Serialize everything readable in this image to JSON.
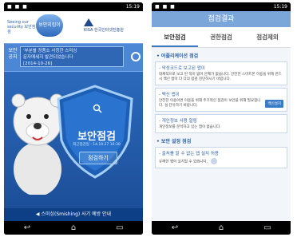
{
  "left_screen": {
    "status_time": "15:19",
    "logo_text": "Seeing our security 보안점검",
    "logo_badge": "보안지킴이",
    "org_name": "KISA 한국인터넷진흥원",
    "notice_tag": "보안 공지",
    "notice_lines": [
      "'부분별 정품소 사칭한 스미싱",
      "문자메세지 발견되었습니다",
      "[2014-10-26]"
    ],
    "shield_title": "보안점검",
    "shield_subtitle": "최근점검일 : 14.10.27 16:30",
    "shield_button": "점검하기",
    "bottom_banner": "◀ 스미싱(Smishing) 사기 예방 안내"
  },
  "right_screen": {
    "status_time": "15:19",
    "title": "점검결과",
    "tabs": [
      "보안점검",
      "권한점검",
      "점검제외"
    ],
    "section1_title": "• 어플리케이션 점검",
    "card1": {
      "title": "- 악성코드로 보고된 앱이",
      "desc": "대체적으로 보고 된 적이 없어 문제가 없습니다. 안전한 스마트폰 이용을 위해 반드시 백신 앱이 다 다의 점검 진단하시기 바랍니다."
    },
    "card2": {
      "title": "- 백신 앱이",
      "desc": "안전한 이용이면 이용을 위해 주기적인 점검이 보안을 위해 필요합니다. 설 단유하기 바랍니다.",
      "button": "백신설치"
    },
    "card3": {
      "title": "- 개인정보 사용 알림",
      "desc": "개인정보를 분석하고 있는 앱이 없습니다."
    },
    "section2_title": "• 보안 설정 점검",
    "card4": {
      "title": "- 출처를 알 수 없는 앱 설치 허용",
      "desc": "유해한 앱이 설치될 수 있습니다."
    }
  },
  "colors": {
    "header_blue": "#7aa6da",
    "tab_underline": "#3a7bc8",
    "screen_blue": "#2f6fc4",
    "banner_navy": "#0d3f86"
  }
}
